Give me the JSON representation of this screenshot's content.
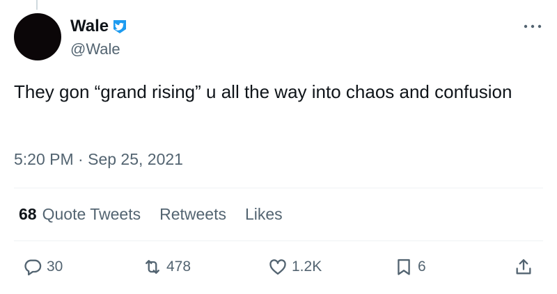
{
  "author": {
    "display_name": "Wale",
    "handle": "@Wale",
    "verified_icon": "twitter-bird-verified-icon"
  },
  "tweet": {
    "text": "They gon “grand rising” u all the way into chaos and confusion",
    "time": "5:20 PM",
    "separator": " · ",
    "date": "Sep 25, 2021"
  },
  "stats": {
    "quote_tweets_count": "68",
    "quote_tweets_label": "Quote Tweets",
    "retweets_label": "Retweets",
    "likes_label": "Likes"
  },
  "actions": {
    "reply_count": "30",
    "retweet_count": "478",
    "like_count": "1.2K",
    "bookmark_count": "6"
  },
  "colors": {
    "text_primary": "#0f1419",
    "text_secondary": "#536471",
    "verified_blue": "#1d9bf0",
    "divider": "#eff3f4"
  }
}
